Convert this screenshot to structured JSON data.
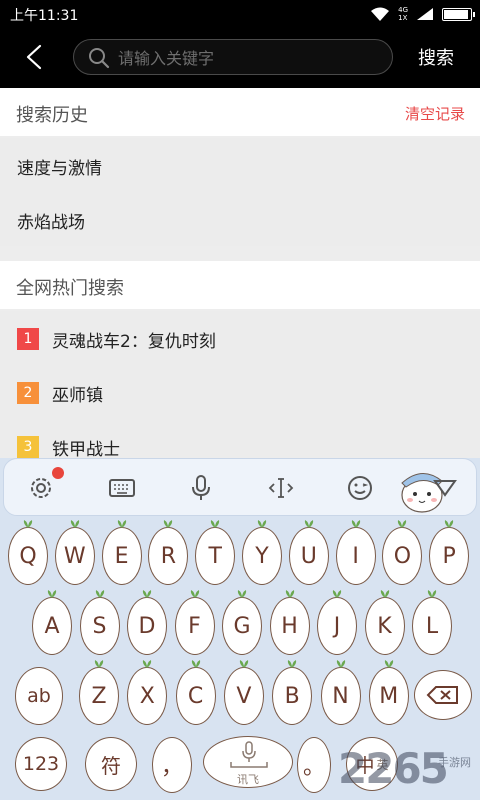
{
  "status_bar": {
    "time": "上午11:31",
    "network_label": "4G\n1X",
    "battery_level": 0.95
  },
  "header": {
    "search_placeholder": "请输入关键字",
    "search_button": "搜索"
  },
  "history": {
    "title": "搜索历史",
    "clear_label": "清空记录",
    "items": [
      "速度与激情",
      "赤焰战场"
    ]
  },
  "hot": {
    "title": "全网热门搜索",
    "items": [
      {
        "rank": "1",
        "label": "灵魂战车2：复仇时刻",
        "color": "#f04848"
      },
      {
        "rank": "2",
        "label": "巫师镇",
        "color": "#f7903a"
      },
      {
        "rank": "3",
        "label": "铁甲战士",
        "color": "#f5c23a"
      }
    ]
  },
  "keyboard": {
    "toolbar_icons": [
      "settings-icon",
      "keyboard-icon",
      "microphone-icon",
      "cursor-icon",
      "emoji-icon",
      "hide-keyboard-icon"
    ],
    "row1": [
      "Q",
      "W",
      "E",
      "R",
      "T",
      "Y",
      "U",
      "I",
      "O",
      "P"
    ],
    "row2": [
      "A",
      "S",
      "D",
      "F",
      "G",
      "H",
      "J",
      "K",
      "L"
    ],
    "row3": [
      "Z",
      "X",
      "C",
      "V",
      "B",
      "N",
      "M"
    ],
    "shift_label": "ab",
    "num_label": "123",
    "symbol_label": "符",
    "comma_label": "，",
    "space_label": "讯飞",
    "period_label": "。",
    "lang_label": "中",
    "lang_alt_label": "英"
  },
  "watermark": {
    "text": "2265",
    "site": "手游网"
  },
  "colors": {
    "accent_red": "#e84a4a",
    "key_text": "#6a3a2c",
    "keyboard_bg": "#d8e3f1"
  }
}
